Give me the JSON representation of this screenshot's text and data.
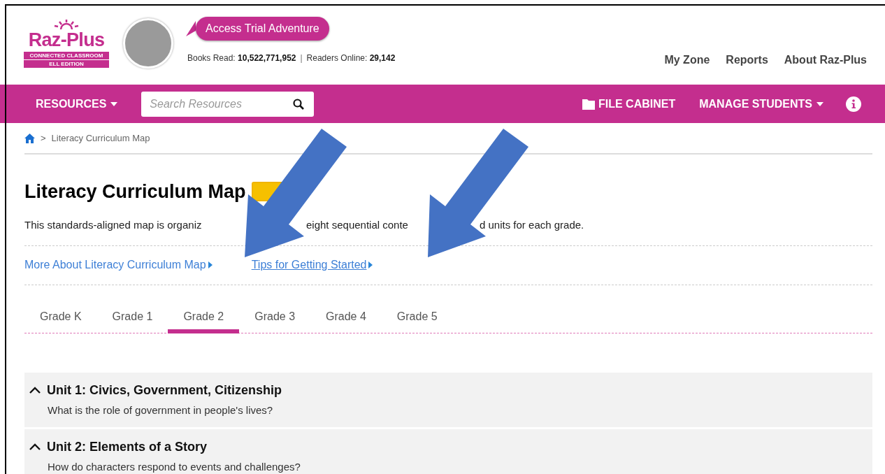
{
  "logo": {
    "name": "Raz-Plus",
    "line_1": "CONNECTED CLASSROOM",
    "line_2": "ELL EDITION"
  },
  "trial_button": "Access Trial Adventure",
  "stats": [
    {
      "label": "Books Read:",
      "value": "10,522,771,952"
    },
    {
      "label": "Readers Online:",
      "value": "29,142"
    }
  ],
  "stat_separator": "|",
  "top_links": [
    "My Zone",
    "Reports",
    "About Raz-Plus"
  ],
  "nav": {
    "resources": "RESOURCES",
    "search": {
      "placeholder": "Search Resources"
    },
    "file_cabinet": "FILE CABINET",
    "manage_students": "MANAGE STUDENTS"
  },
  "breadcrumb": {
    "separator": ">",
    "current": "Literacy Curriculum Map"
  },
  "title": "Literacy Curriculum Map",
  "description_fragments": [
    "This standards-aligned map is organiz",
    "eight sequential conte",
    "d units for each grade."
  ],
  "links": [
    {
      "label": "More About Literacy Curriculum Map",
      "underlined": false
    },
    {
      "label": "Tips for Getting Started",
      "underlined": true
    }
  ],
  "tabs": [
    {
      "label": "Grade K",
      "selected": false
    },
    {
      "label": "Grade 1",
      "selected": false
    },
    {
      "label": "Grade 2",
      "selected": true
    },
    {
      "label": "Grade 3",
      "selected": false
    },
    {
      "label": "Grade 4",
      "selected": false
    },
    {
      "label": "Grade 5",
      "selected": false
    }
  ],
  "units": [
    {
      "title": "Unit 1: Civics, Government, Citizenship",
      "question": "What is the role of government in people's lives?",
      "expanded": true
    },
    {
      "title": "Unit 2: Elements of a Story",
      "question": "How do characters respond to events and challenges?",
      "expanded": true
    }
  ]
}
